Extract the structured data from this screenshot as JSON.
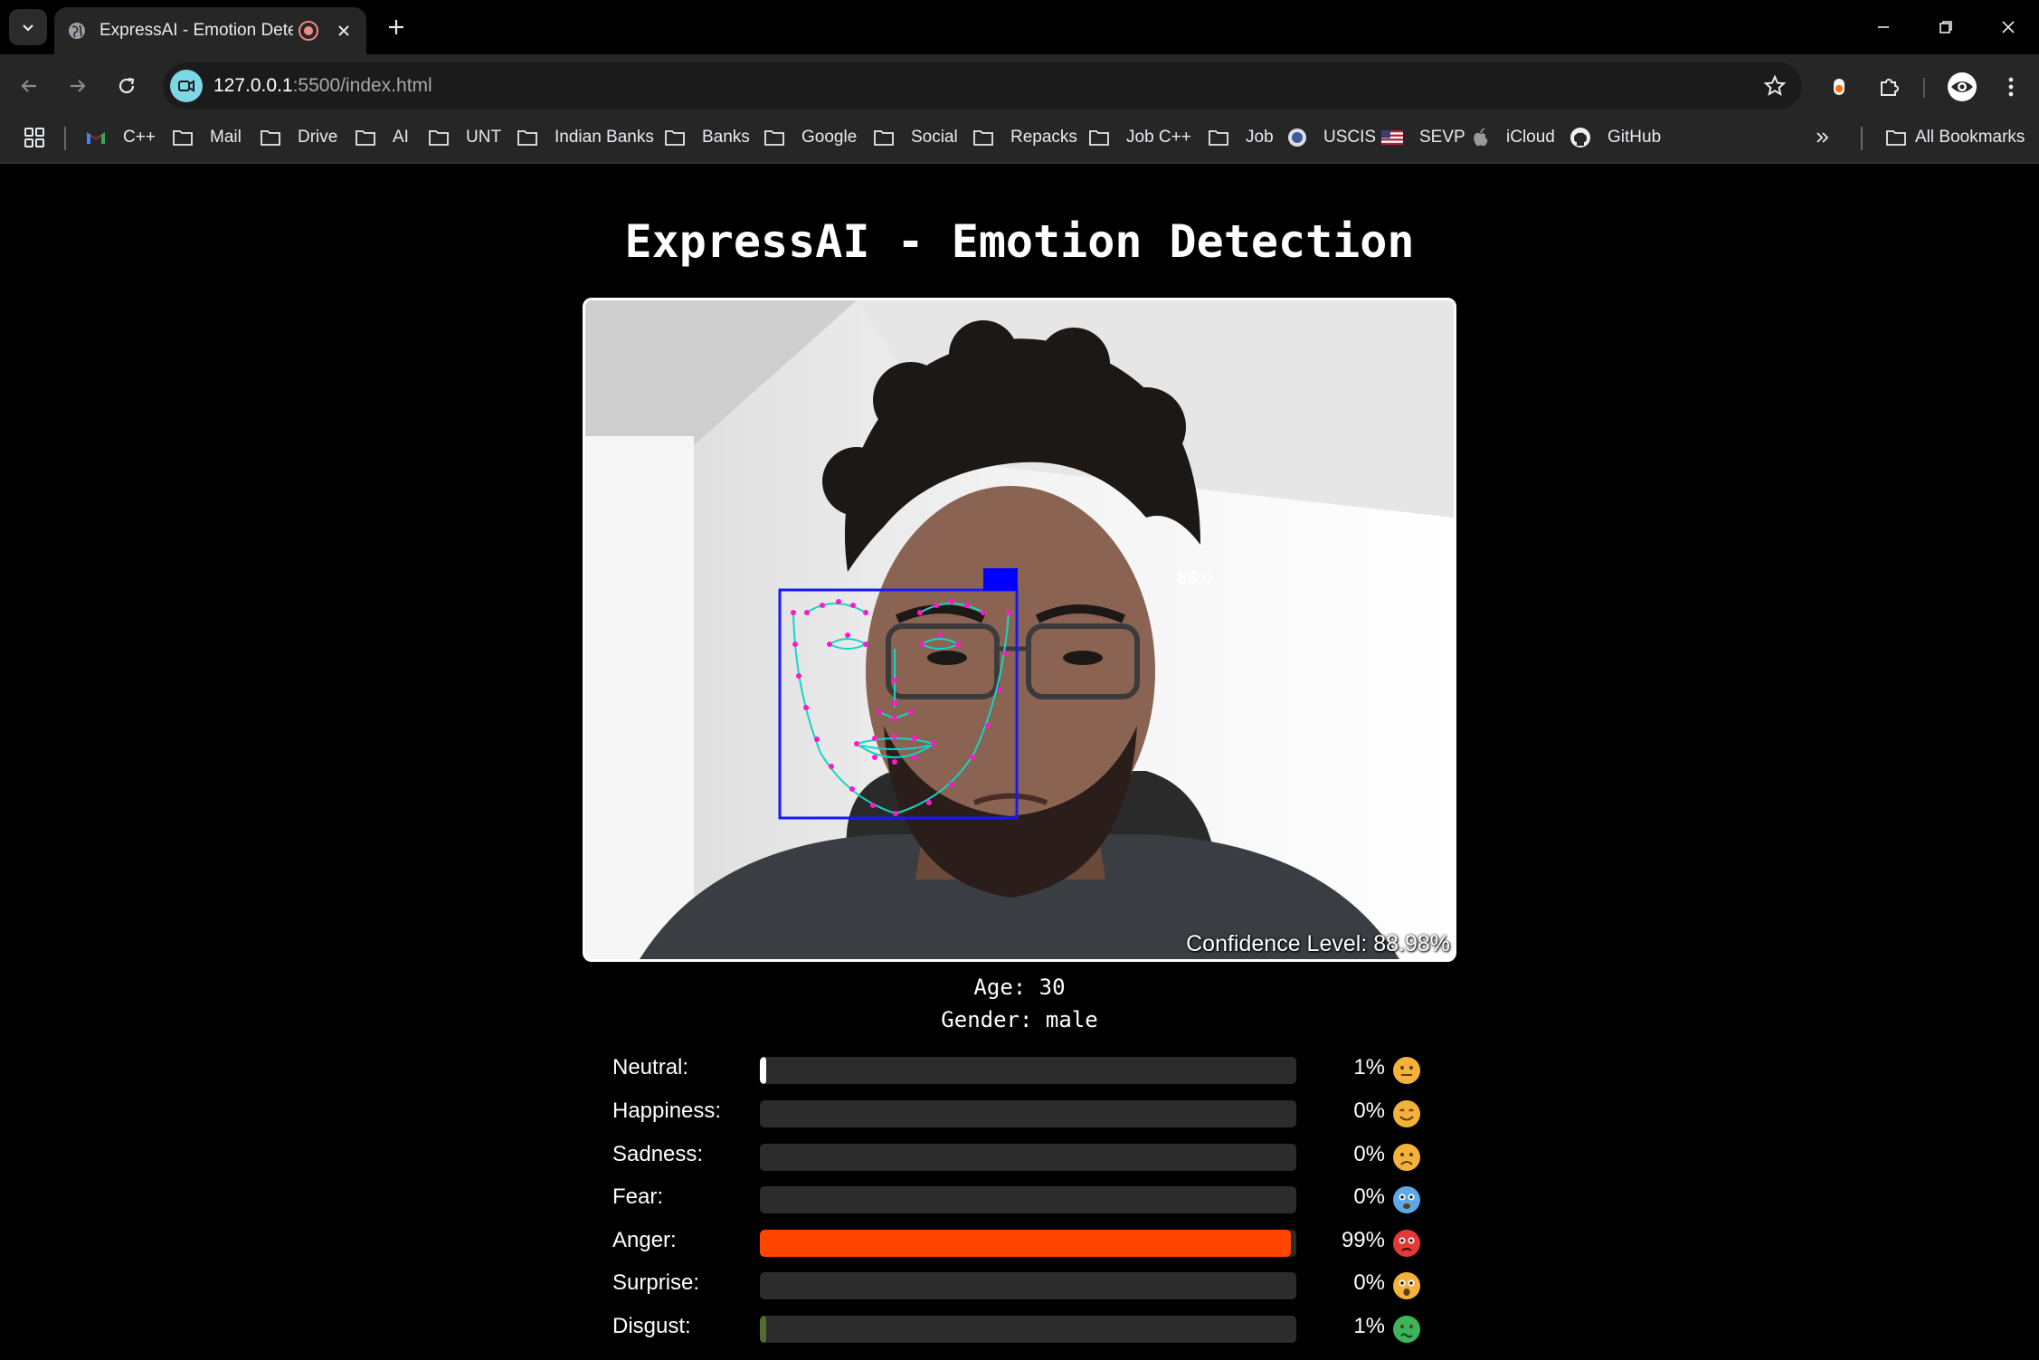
{
  "browser": {
    "tab": {
      "title": "ExpressAI - Emotion Detecti"
    },
    "url": {
      "host": "127.0.0.1",
      "path": ":5500/index.html"
    },
    "bookmarks": [
      {
        "label": "C++",
        "icon": "gmail-icon"
      },
      {
        "label": "Mail",
        "icon": "folder-icon"
      },
      {
        "label": "Drive",
        "icon": "folder-icon"
      },
      {
        "label": "AI",
        "icon": "folder-icon"
      },
      {
        "label": "UNT",
        "icon": "folder-icon"
      },
      {
        "label": "Indian Banks",
        "icon": "folder-icon"
      },
      {
        "label": "Banks",
        "icon": "folder-icon"
      },
      {
        "label": "Google",
        "icon": "folder-icon"
      },
      {
        "label": "Social",
        "icon": "folder-icon"
      },
      {
        "label": "Repacks",
        "icon": "folder-icon"
      },
      {
        "label": "Job C++",
        "icon": "folder-icon"
      },
      {
        "label": "Job",
        "icon": "folder-icon"
      },
      {
        "label": "USCIS",
        "icon": "uscis-seal-icon"
      },
      {
        "label": "SEVP",
        "icon": "us-flag-icon"
      },
      {
        "label": "iCloud",
        "icon": "apple-icon"
      },
      {
        "label": "GitHub",
        "icon": "github-icon"
      }
    ],
    "all_bookmarks": "All Bookmarks"
  },
  "page": {
    "title": "ExpressAI - Emotion Detection",
    "face_box_label": "88.o",
    "confidence": "Confidence Level: 88.98%",
    "age": "Age: 30",
    "gender": "Gender: male"
  },
  "emotions": [
    {
      "label": "Neutral:",
      "value": 1,
      "pct": "1%",
      "color": "#ffffff",
      "icon": "neutral-face-icon"
    },
    {
      "label": "Happiness:",
      "value": 0,
      "pct": "0%",
      "color": "#ffd54f",
      "icon": "smiling-face-icon"
    },
    {
      "label": "Sadness:",
      "value": 0,
      "pct": "0%",
      "color": "#64b5f6",
      "icon": "sad-face-icon"
    },
    {
      "label": "Fear:",
      "value": 0,
      "pct": "0%",
      "color": "#9575cd",
      "icon": "fearful-face-icon"
    },
    {
      "label": "Anger:",
      "value": 99,
      "pct": "99%",
      "color": "#ff4500",
      "icon": "angry-face-icon"
    },
    {
      "label": "Surprise:",
      "value": 0,
      "pct": "0%",
      "color": "#ffb74d",
      "icon": "surprised-face-icon"
    },
    {
      "label": "Disgust:",
      "value": 1,
      "pct": "1%",
      "color": "#556b2f",
      "icon": "disgusted-face-icon"
    }
  ]
}
